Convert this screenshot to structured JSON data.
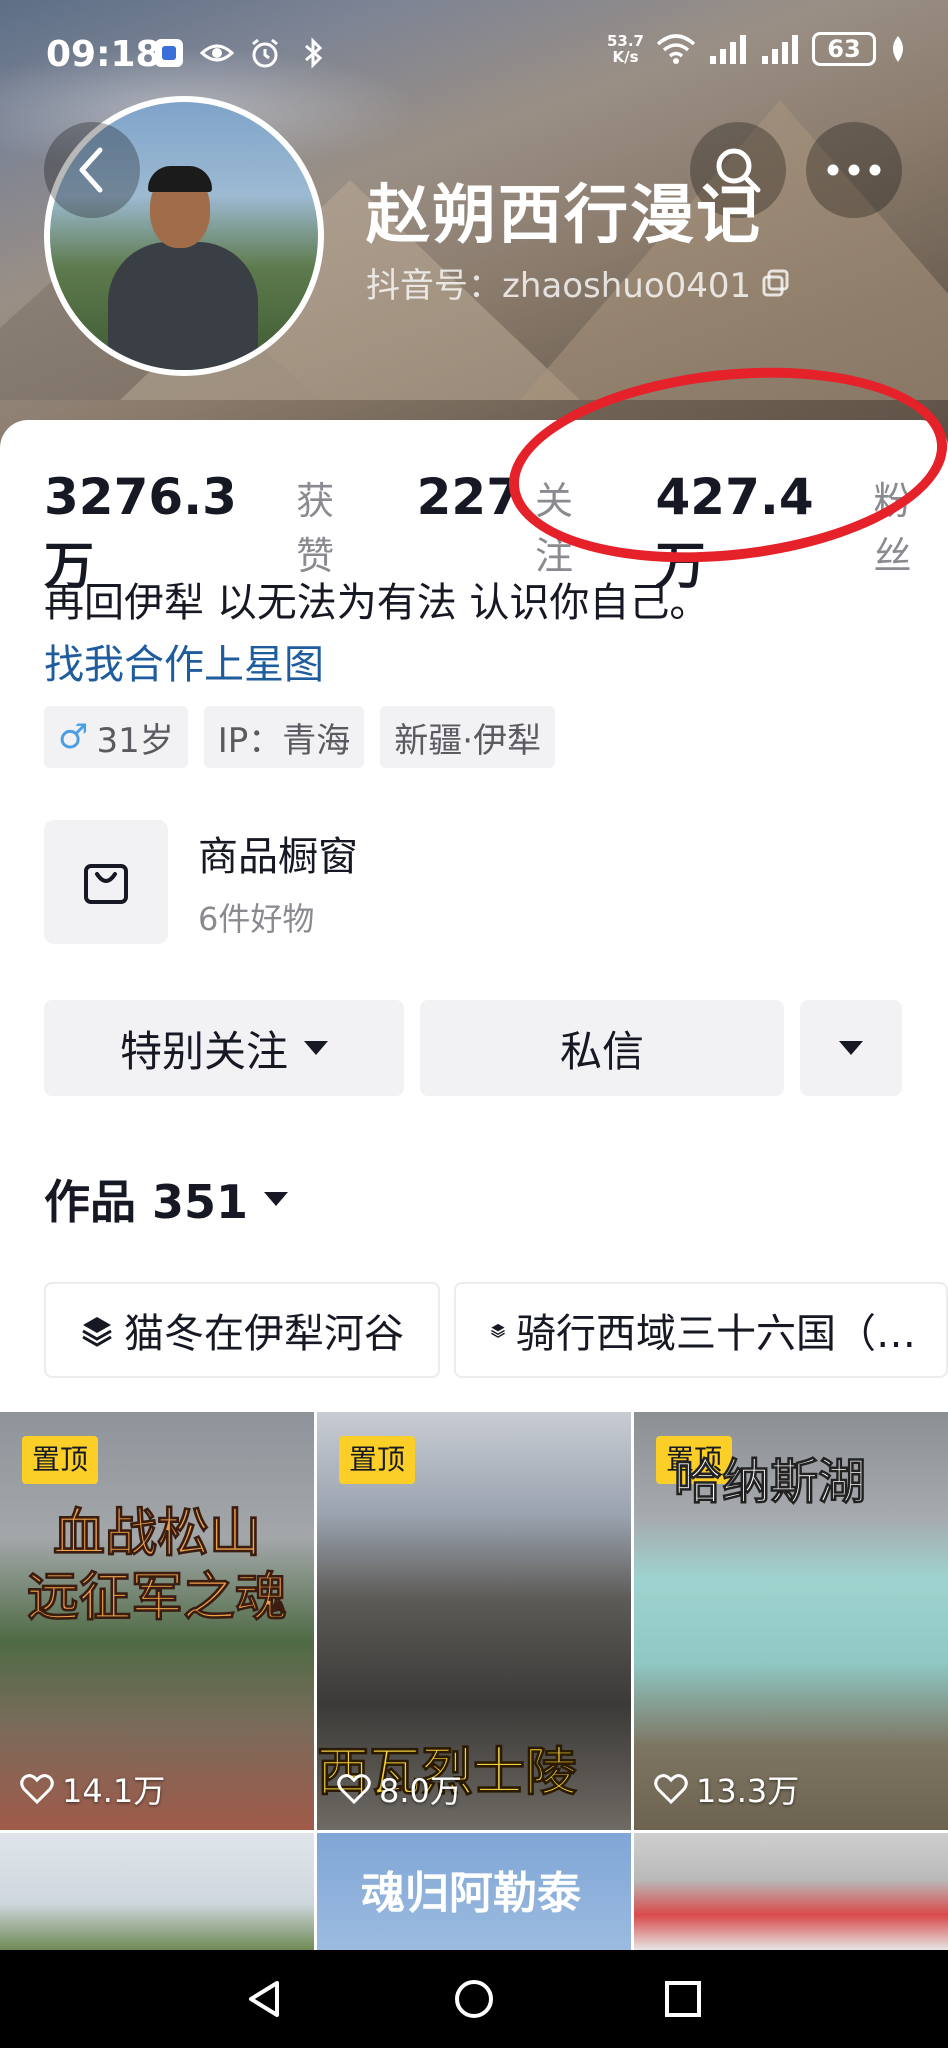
{
  "status_bar": {
    "time": "09:18",
    "net_speed_value": "53.7",
    "net_speed_unit": "K/s",
    "battery": "63"
  },
  "profile": {
    "name": "赵朔西行漫记",
    "douyin_id": "抖音号：zhaoshuo0401"
  },
  "stats": [
    {
      "value": "3276.3万",
      "label": "获赞"
    },
    {
      "value": "227",
      "label": "关注"
    },
    {
      "value": "427.4万",
      "label": "粉丝"
    }
  ],
  "bio": "再回伊犁 以无法为有法 认识你自己。",
  "cooperation_link": "找我合作上星图",
  "tags": {
    "gender_sign": "♂",
    "age": "31岁",
    "ip": "IP：青海",
    "location": "新疆·伊犁"
  },
  "shop": {
    "title": "商品橱窗",
    "subtitle": "6件好物"
  },
  "actions": {
    "follow_label": "特别关注",
    "message_label": "私信"
  },
  "works": {
    "label": "作品 351"
  },
  "collections": [
    "猫冬在伊犁河谷",
    "骑行西域三十六国（…"
  ],
  "videos": [
    {
      "pin": "置顶",
      "caption": "血战松山\n远征军之魂",
      "likes": "14.1万"
    },
    {
      "pin": "置顶",
      "caption": "西瓦烈士陵",
      "likes": "8.0万"
    },
    {
      "pin": "置顶",
      "caption": "哈纳斯湖",
      "likes": "13.3万"
    },
    {
      "caption": ""
    },
    {
      "caption": "魂归阿勒泰"
    },
    {
      "caption": ""
    }
  ],
  "colors": {
    "accent_link": "#1f5c9e",
    "pin_badge": "#fbcf27",
    "highlight_circle": "#e5212a"
  }
}
